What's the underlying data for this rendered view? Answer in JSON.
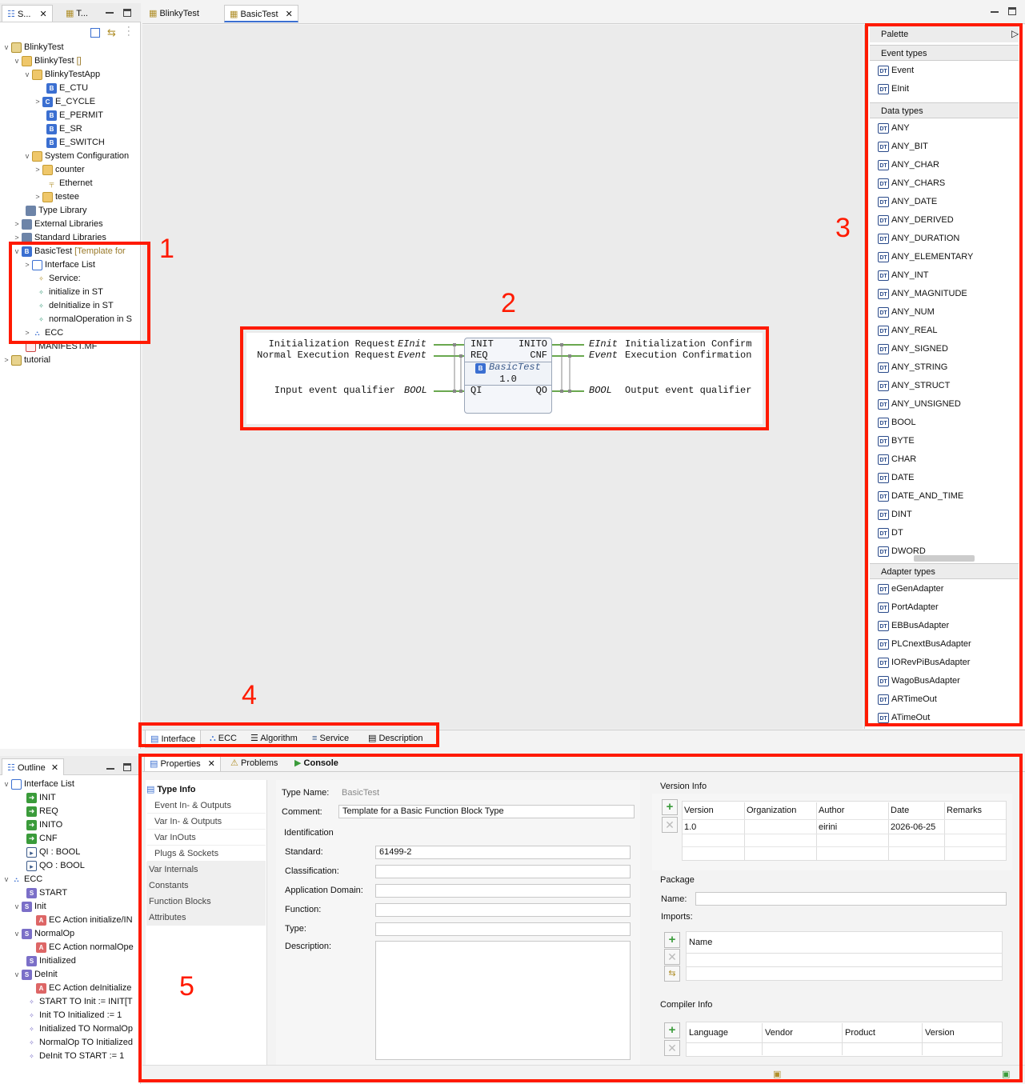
{
  "left_tabs": [
    "S...",
    "T..."
  ],
  "editor_tabs": [
    "BlinkyTest",
    "BasicTest"
  ],
  "tree": [
    {
      "label": "BlinkyTest",
      "suffix": ""
    },
    {
      "label": "BlinkyTest",
      "suffix": "[]"
    },
    {
      "label": "BlinkyTestApp",
      "suffix": ""
    },
    {
      "label": "E_CTU",
      "suffix": ""
    },
    {
      "label": "E_CYCLE",
      "suffix": ""
    },
    {
      "label": "E_PERMIT",
      "suffix": ""
    },
    {
      "label": "E_SR",
      "suffix": ""
    },
    {
      "label": "E_SWITCH",
      "suffix": ""
    },
    {
      "label": "System Configuration",
      "suffix": ""
    },
    {
      "label": "counter",
      "suffix": ""
    },
    {
      "label": "Ethernet",
      "suffix": ""
    },
    {
      "label": "testee",
      "suffix": ""
    },
    {
      "label": "Type Library",
      "suffix": ""
    },
    {
      "label": "External Libraries",
      "suffix": ""
    },
    {
      "label": "Standard Libraries",
      "suffix": ""
    },
    {
      "label": "BasicTest",
      "suffix": "[Template for"
    },
    {
      "label": "Interface List",
      "suffix": ""
    },
    {
      "label": "Service:",
      "suffix": ""
    },
    {
      "label": "initialize in ST",
      "suffix": ""
    },
    {
      "label": "deInitialize in ST",
      "suffix": ""
    },
    {
      "label": "normalOperation in S",
      "suffix": ""
    },
    {
      "label": "ECC",
      "suffix": ""
    },
    {
      "label": "MANIFEST.MF",
      "suffix": ""
    },
    {
      "label": "tutorial",
      "suffix": ""
    }
  ],
  "annotations": [
    "1",
    "2",
    "3",
    "4",
    "5"
  ],
  "fb": {
    "left_labels": [
      "Initialization Request",
      "Normal Execution Request",
      "Input event qualifier"
    ],
    "left_types": [
      "EInit",
      "Event",
      "BOOL"
    ],
    "in_ports": [
      "INIT",
      "REQ",
      "QI"
    ],
    "out_ports": [
      "INITO",
      "CNF",
      "QO"
    ],
    "right_types": [
      "EInit",
      "Event",
      "BOOL"
    ],
    "right_labels": [
      "Initialization Confirm",
      "Execution Confirmation",
      "Output event qualifier"
    ],
    "name": "BasicTest",
    "version": "1.0"
  },
  "palette": {
    "title": "Palette",
    "event_header": "Event types",
    "event_types": [
      "Event",
      "EInit"
    ],
    "data_header": "Data types",
    "data_types": [
      "ANY",
      "ANY_BIT",
      "ANY_CHAR",
      "ANY_CHARS",
      "ANY_DATE",
      "ANY_DERIVED",
      "ANY_DURATION",
      "ANY_ELEMENTARY",
      "ANY_INT",
      "ANY_MAGNITUDE",
      "ANY_NUM",
      "ANY_REAL",
      "ANY_SIGNED",
      "ANY_STRING",
      "ANY_STRUCT",
      "ANY_UNSIGNED",
      "BOOL",
      "BYTE",
      "CHAR",
      "DATE",
      "DATE_AND_TIME",
      "DINT",
      "DT",
      "DWORD"
    ],
    "adapter_header": "Adapter types",
    "adapter_types": [
      "eGenAdapter",
      "PortAdapter",
      "EBBusAdapter",
      "PLCnextBusAdapter",
      "IORevPiBusAdapter",
      "WagoBusAdapter",
      "ARTimeOut",
      "ATimeOut"
    ]
  },
  "editor_bottom_tabs": [
    "Interface",
    "ECC",
    "Algorithm",
    "Service",
    "Description"
  ],
  "outline": {
    "title": "Outline",
    "rows": [
      "Interface List",
      "INIT",
      "REQ",
      "INITO",
      "CNF",
      "QI : BOOL",
      "QO : BOOL",
      "ECC",
      "START",
      "Init",
      "EC Action initialize/IN",
      "NormalOp",
      "EC Action normalOpe",
      "Initialized",
      "DeInit",
      "EC Action deInitialize",
      "START TO Init := INIT[T",
      "Init TO Initialized := 1",
      "Initialized TO NormalOp",
      "NormalOp TO Initialized",
      "DeInit TO START := 1"
    ]
  },
  "properties": {
    "tabs": [
      "Properties",
      "Problems",
      "Console"
    ],
    "nav": [
      "Type Info",
      "Event In- & Outputs",
      "Var In- & Outputs",
      "Var InOuts",
      "Plugs & Sockets",
      "Var Internals",
      "Constants",
      "Function Blocks",
      "Attributes"
    ],
    "type_name_label": "Type Name:",
    "type_name": "BasicTest",
    "comment_label": "Comment:",
    "comment": "Template for a Basic Function Block Type",
    "identification": "Identification",
    "standard_label": "Standard:",
    "standard": "61499-2",
    "classification_label": "Classification:",
    "app_domain_label": "Application Domain:",
    "function_label": "Function:",
    "type_label": "Type:",
    "description_label": "Description:",
    "version_info": "Version Info",
    "version_cols": [
      "Version",
      "Organization",
      "Author",
      "Date",
      "Remarks"
    ],
    "version_row": [
      "1.0",
      "",
      "eirini",
      "2026-06-25",
      ""
    ],
    "package": "Package",
    "name_label": "Name:",
    "imports_label": "Imports:",
    "imports_col": "Name",
    "compiler_info": "Compiler Info",
    "compiler_cols": [
      "Language",
      "Vendor",
      "Product",
      "Version"
    ]
  }
}
